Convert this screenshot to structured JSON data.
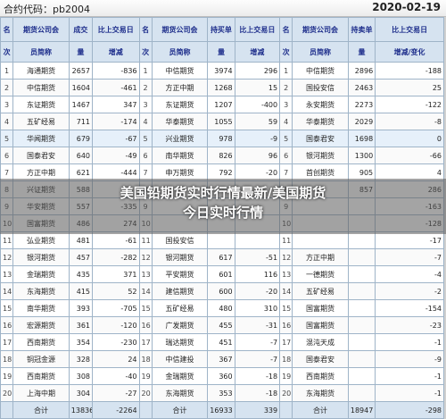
{
  "titlebar": {
    "contract_label": "合约代码：pb2004",
    "date": "2020-02-19"
  },
  "headers": {
    "rank": [
      "名",
      "次"
    ],
    "g1": [
      "期货公司会",
      "员简称"
    ],
    "g1_vol": [
      "成交",
      "量"
    ],
    "g1_chg": [
      "比上交易日",
      "增减"
    ],
    "g2": [
      "期货公司会",
      "员简称"
    ],
    "g2_vol": [
      "持买单",
      "量"
    ],
    "g2_chg": [
      "比上交易日",
      "增减"
    ],
    "g3": [
      "期货公司会",
      "员简称"
    ],
    "g3_vol": [
      "持卖单",
      "量"
    ],
    "g3_chg": [
      "比上交易日",
      "增减/变化"
    ]
  },
  "rows": [
    [
      "1",
      "海通期货",
      "2657",
      "-836",
      "1",
      "中信期货",
      "3974",
      "296",
      "1",
      "中信期货",
      "2896",
      "-188"
    ],
    [
      "2",
      "中信期货",
      "1604",
      "-461",
      "2",
      "方正中期",
      "1268",
      "15",
      "2",
      "国投安信",
      "2463",
      "25"
    ],
    [
      "3",
      "东证期货",
      "1467",
      "347",
      "3",
      "东证期货",
      "1207",
      "-400",
      "3",
      "永安期货",
      "2273",
      "-122"
    ],
    [
      "4",
      "五矿经易",
      "711",
      "-174",
      "4",
      "华泰期货",
      "1055",
      "59",
      "4",
      "华泰期货",
      "2029",
      "-8"
    ],
    [
      "5",
      "华闻期货",
      "679",
      "-67",
      "5",
      "兴业期货",
      "978",
      "-9",
      "5",
      "国泰君安",
      "1698",
      "0"
    ],
    [
      "6",
      "国泰君安",
      "640",
      "-49",
      "6",
      "南华期货",
      "826",
      "96",
      "6",
      "银河期货",
      "1300",
      "-66"
    ],
    [
      "7",
      "方正中期",
      "621",
      "-444",
      "7",
      "申万期货",
      "792",
      "-20",
      "7",
      "首创期货",
      "905",
      "4"
    ],
    [
      "8",
      "兴证期货",
      "588",
      "-",
      "8",
      "",
      "",
      "",
      "8",
      "",
      "857",
      "286"
    ],
    [
      "9",
      "华安期货",
      "557",
      "-335",
      "9",
      "",
      "",
      "",
      "9",
      "",
      "",
      "-163"
    ],
    [
      "10",
      "国富期货",
      "486",
      "274",
      "10",
      "",
      "",
      "",
      "10",
      "",
      "",
      "-128"
    ],
    [
      "11",
      "弘业期货",
      "481",
      "-61",
      "11",
      "国投安信",
      "",
      "",
      "11",
      "",
      "",
      "-17"
    ],
    [
      "12",
      "银河期货",
      "457",
      "-282",
      "12",
      "银河期货",
      "617",
      "-51",
      "12",
      "方正中期",
      "",
      "-7"
    ],
    [
      "13",
      "金瑞期货",
      "435",
      "371",
      "13",
      "平安期货",
      "601",
      "116",
      "13",
      "一德期货",
      "",
      "-4"
    ],
    [
      "14",
      "东海期货",
      "415",
      "52",
      "14",
      "建信期货",
      "600",
      "-20",
      "14",
      "五矿经易",
      "",
      "-2"
    ],
    [
      "15",
      "南华期货",
      "393",
      "-705",
      "15",
      "五矿经易",
      "480",
      "310",
      "15",
      "国富期货",
      "",
      "-154"
    ],
    [
      "16",
      "宏源期货",
      "361",
      "-120",
      "16",
      "广发期货",
      "455",
      "-31",
      "16",
      "国富期货",
      "",
      "-23"
    ],
    [
      "17",
      "西南期货",
      "354",
      "-230",
      "17",
      "瑞达期货",
      "451",
      "-7",
      "17",
      "混沌天成",
      "",
      "-1"
    ],
    [
      "18",
      "铜冠金源",
      "328",
      "24",
      "18",
      "中信建投",
      "367",
      "-7",
      "18",
      "国泰君安",
      "",
      "-9"
    ],
    [
      "19",
      "西南期货",
      "308",
      "-40",
      "19",
      "金瑞期货",
      "360",
      "-18",
      "19",
      "西南期货",
      "",
      "-1"
    ],
    [
      "20",
      "上海中期",
      "304",
      "-27",
      "20",
      "东海期货",
      "353",
      "-18",
      "20",
      "东海期货",
      "",
      "-1"
    ]
  ],
  "total": {
    "label": "合计",
    "vol": "13836",
    "chg": "-2264",
    "hold_buy": "16933",
    "hold_buy_chg": "339",
    "hold_sell": "18947",
    "hold_sell_chg": "-298"
  },
  "overlay": {
    "line1": "美国铅期货实时行情最新/美国期货",
    "line2": "今日实时行情"
  }
}
